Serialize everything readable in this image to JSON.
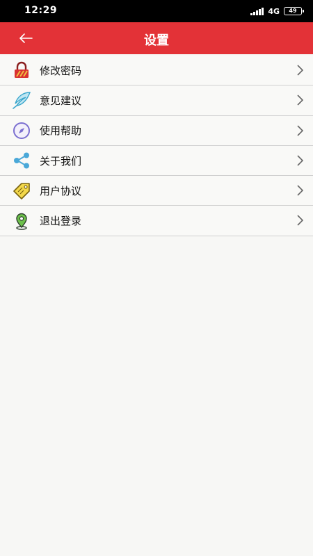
{
  "status_bar": {
    "time": "12:29",
    "network": "4G",
    "battery": "49"
  },
  "header": {
    "title": "设置",
    "back_icon": "arrow-left-icon",
    "background": "#e33237"
  },
  "menu": {
    "items": [
      {
        "label": "修改密码",
        "icon": "padlock-icon"
      },
      {
        "label": "意见建议",
        "icon": "feather-icon"
      },
      {
        "label": "使用帮助",
        "icon": "compass-icon"
      },
      {
        "label": "关于我们",
        "icon": "share-icon"
      },
      {
        "label": "用户协议",
        "icon": "tag-icon"
      },
      {
        "label": "退出登录",
        "icon": "location-pin-icon"
      }
    ]
  }
}
